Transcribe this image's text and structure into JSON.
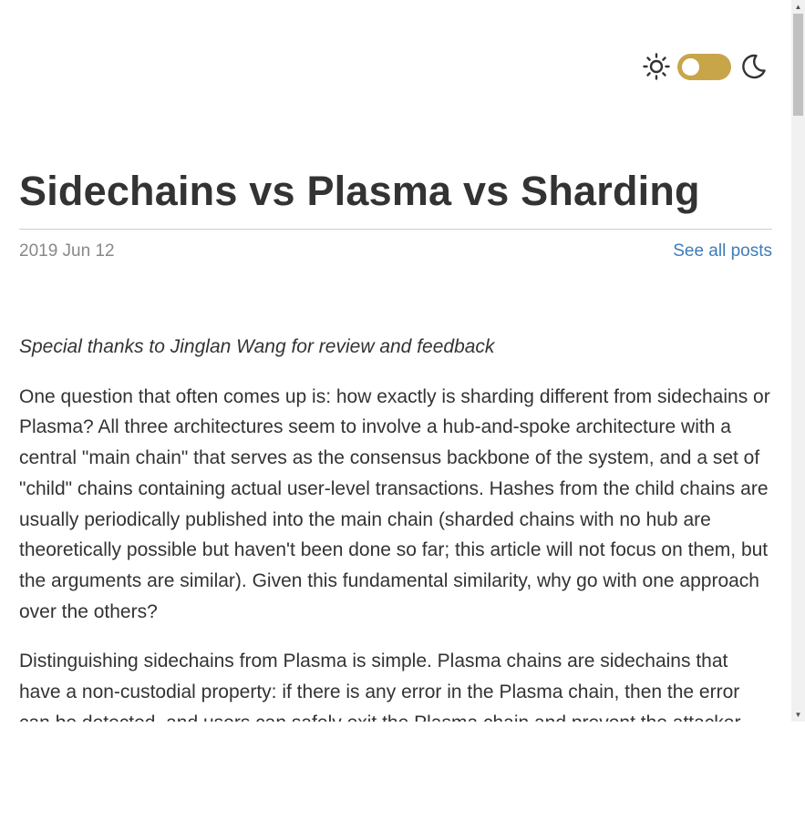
{
  "theme_switch": {
    "sun_icon": "sun-icon",
    "moon_icon": "moon-icon",
    "toggle_color": "#c9a54a"
  },
  "post": {
    "title": "Sidechains vs Plasma vs Sharding",
    "date": "2019 Jun 12",
    "see_all_label": "See all posts",
    "link_color": "#3e7cb8",
    "paragraphs": [
      "Special thanks to Jinglan Wang for review and feedback",
      "One question that often comes up is: how exactly is sharding different from sidechains or Plasma? All three architectures seem to involve a hub-and-spoke architecture with a central \"main chain\" that serves as the consensus backbone of the system, and a set of \"child\" chains containing actual user-level transactions. Hashes from the child chains are usually periodically published into the main chain (sharded chains with no hub are theoretically possible but haven't been done so far; this article will not focus on them, but the arguments are similar). Given this fundamental similarity, why go with one approach over the others?",
      "Distinguishing sidechains from Plasma is simple. Plasma chains are sidechains that have a non-custodial property: if there is any error in the Plasma chain, then the error can be detected, and users can safely exit the Plasma chain and prevent the attacker from doing any lasting damage."
    ]
  },
  "scrollbar": {
    "up_arrow": "▲",
    "down_arrow": "▼"
  }
}
